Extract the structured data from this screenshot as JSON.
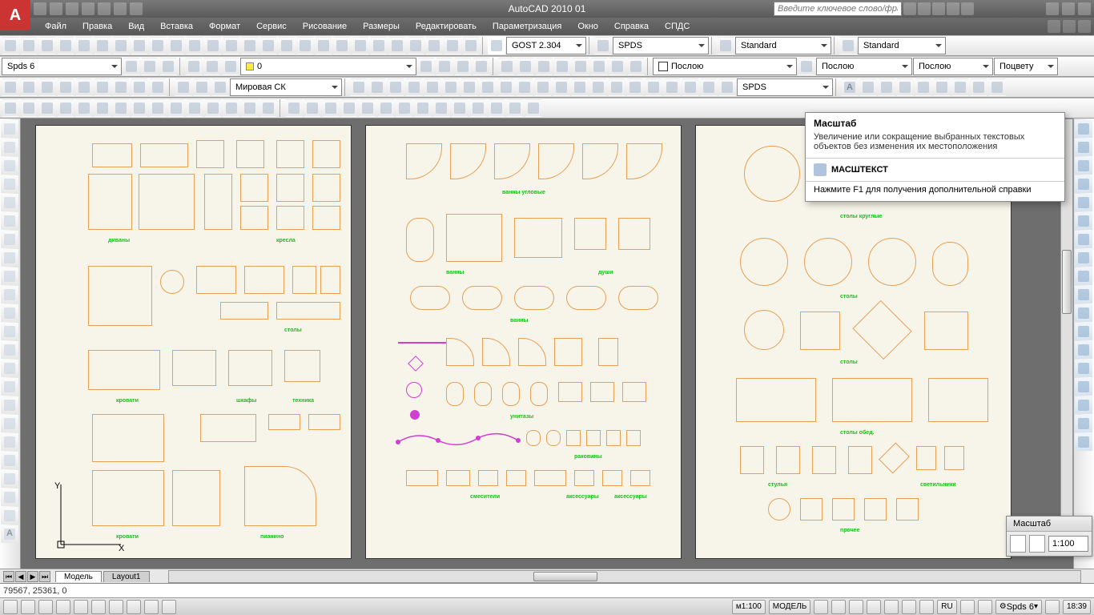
{
  "app": {
    "title": "AutoCAD 2010   01"
  },
  "infocenter": {
    "placeholder": "Введите ключевое слово/фразу"
  },
  "menu": [
    "Файл",
    "Правка",
    "Вид",
    "Вставка",
    "Формат",
    "Сервис",
    "Рисование",
    "Размеры",
    "Редактировать",
    "Параметризация",
    "Окно",
    "Справка",
    "СПДС"
  ],
  "dropdowns": {
    "textstyle": "GOST 2.304",
    "spds_combo": "SPDS",
    "standard1": "Standard",
    "standard2": "Standard",
    "spds6": "Spds 6",
    "zero": "0",
    "bylayer1": "Послою",
    "bylayer2": "Послою",
    "bylayer3": "Послою",
    "bycolor": "Поцвету",
    "worldcs": "Мировая СК",
    "spds_right": "SPDS"
  },
  "tooltip": {
    "title": "Масштаб",
    "desc": "Увеличение или сокращение выбранных текстовых объектов без изменения их местоположения",
    "cmd": "МАСШТЕКСТ",
    "help": "Нажмите F1 для получения дополнительной справки"
  },
  "scale_window": {
    "title": "Масштаб",
    "value": "1:100"
  },
  "tabs": {
    "model": "Модель",
    "layout1": "Layout1"
  },
  "cmdline": "79567, 25361, 0",
  "status": {
    "mscale": "м1:100",
    "model_btn": "МОДЕЛЬ",
    "spds6": "Spds 6",
    "lang": "RU",
    "time": "18:39"
  },
  "sheets": {
    "s1": {
      "labels": [
        "диваны",
        "кресла",
        "столы",
        "кровати",
        "шкафы",
        "техника",
        "пианино"
      ]
    },
    "s2": {
      "labels": [
        "ванны угловые",
        "ванны",
        "души",
        "унитазы",
        "раковины",
        "смесители",
        "аксессуары"
      ]
    },
    "s3": {
      "labels": [
        "столы круглые",
        "столы",
        "столы обед.",
        "стулья",
        "светильники",
        "прочее"
      ]
    }
  }
}
